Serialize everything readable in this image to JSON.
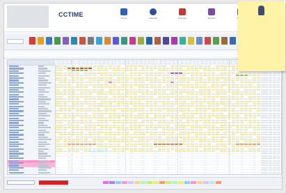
{
  "app": {
    "brand": "CCTIME",
    "brand_sub": ""
  },
  "nav": [
    {
      "label": "Home",
      "color": "#2c62b8"
    },
    {
      "label": "Calendar",
      "color": "#2f4f98"
    },
    {
      "label": "Planning",
      "color": "#c03a3a"
    },
    {
      "label": "Reports",
      "color": "#7a4aa6"
    },
    {
      "label": "Settings",
      "color": "#8c3c6c"
    }
  ],
  "sticky_note": {
    "text": ""
  },
  "toolbar": {
    "select_value": "",
    "settings_label": ""
  },
  "filters": {
    "group": "",
    "period": "",
    "month": "",
    "summary": ""
  },
  "grid": {
    "name_header": "",
    "day_headers": []
  },
  "status": {
    "left_value": "",
    "legend_label": ""
  },
  "legend_colors": [
    "#e36cf0",
    "#b07cf0",
    "#8bd0f0",
    "#f09ad0",
    "#d6c6f5",
    "#fad28c",
    "#b4f5b8",
    "#c8f06c",
    "#f0ec74",
    "#ff9a6a",
    "#b8ecec",
    "#f2b2c0"
  ]
}
